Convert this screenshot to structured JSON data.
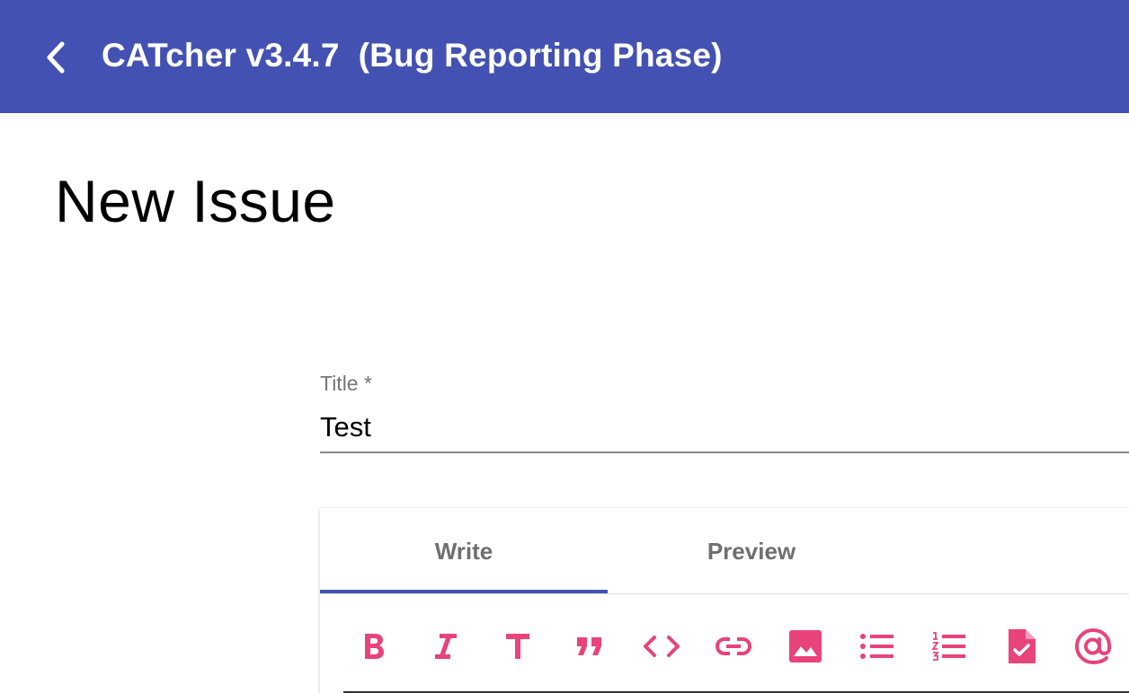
{
  "app_bar": {
    "back_icon": "arrow-back-icon",
    "title": "CATcher v3.4.7  (Bug Reporting Phase)",
    "background_color": "#4352b2"
  },
  "page": {
    "heading": "New Issue"
  },
  "title_field": {
    "label": "Title *",
    "value": "Test"
  },
  "editor": {
    "tabs": [
      {
        "label": "Write",
        "selected": true
      },
      {
        "label": "Preview",
        "selected": false
      }
    ],
    "toolbar": {
      "icon_color": "#e8437a",
      "icons": [
        "bold-icon",
        "italic-icon",
        "heading-icon",
        "quote-icon",
        "code-icon",
        "link-icon",
        "image-icon",
        "bulleted-list-icon",
        "numbered-list-icon",
        "task-list-icon",
        "mention-icon"
      ]
    }
  }
}
